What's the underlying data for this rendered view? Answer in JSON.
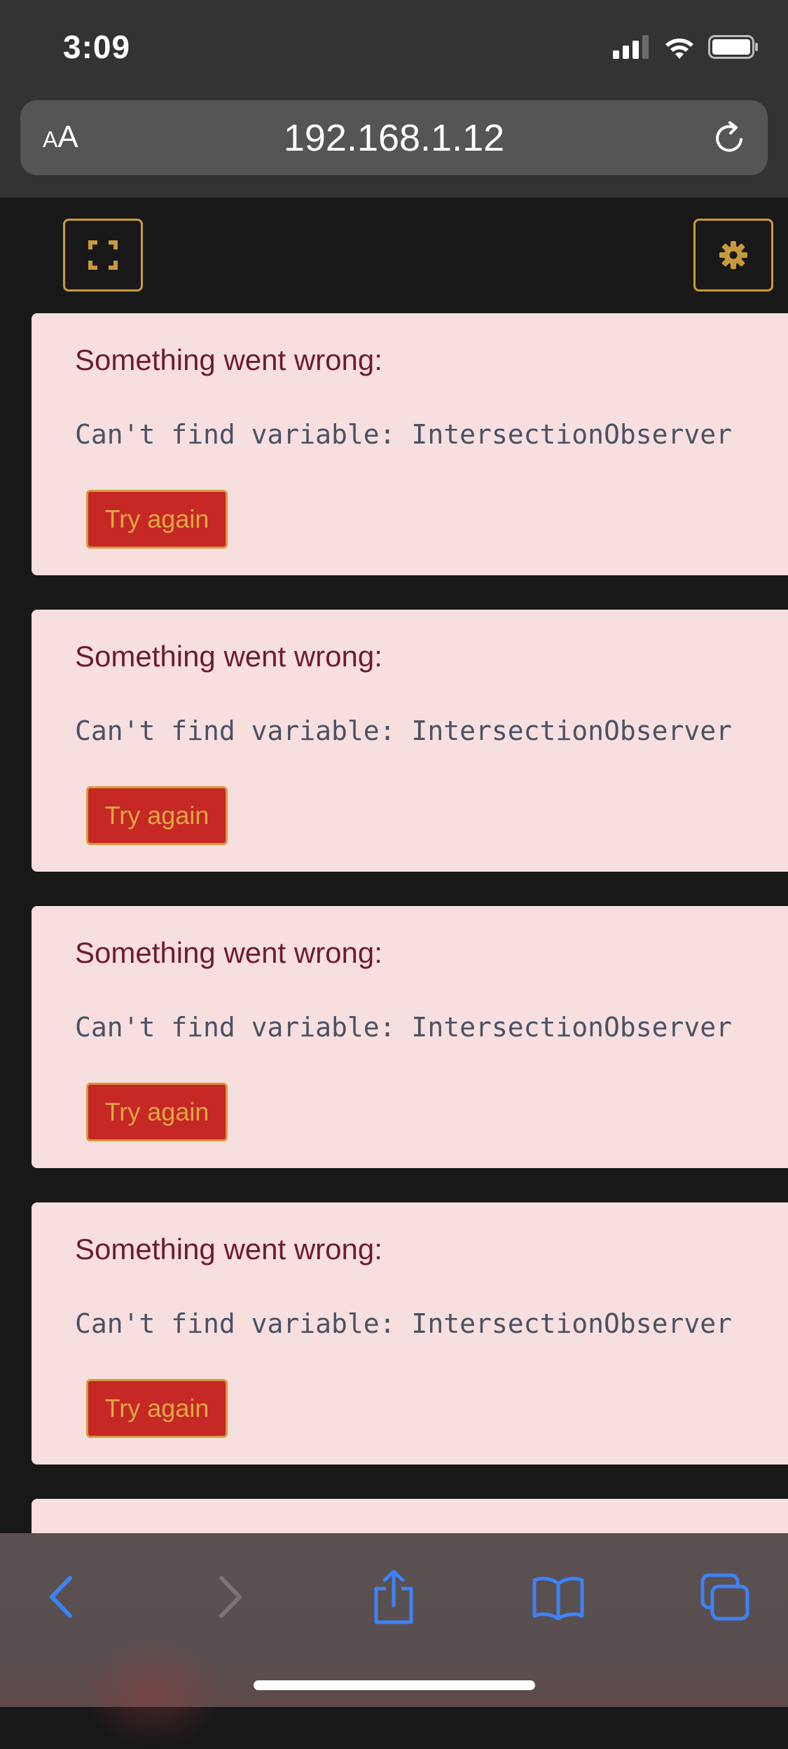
{
  "status_bar": {
    "time": "3:09"
  },
  "browser": {
    "text_size_label_small": "A",
    "text_size_label_large": "A",
    "url": "192.168.1.12"
  },
  "page": {
    "errors": [
      {
        "title": "Something went wrong:",
        "message": "Can't find variable: IntersectionObserver",
        "button_label": "Try again"
      },
      {
        "title": "Something went wrong:",
        "message": "Can't find variable: IntersectionObserver",
        "button_label": "Try again"
      },
      {
        "title": "Something went wrong:",
        "message": "Can't find variable: IntersectionObserver",
        "button_label": "Try again"
      },
      {
        "title": "Something went wrong:",
        "message": "Can't find variable: IntersectionObserver",
        "button_label": "Try again"
      }
    ]
  },
  "icons": {
    "fullscreen": "fullscreen-icon",
    "settings": "gear-icon",
    "back": "chevron-left-icon",
    "forward": "chevron-right-icon",
    "share": "share-icon",
    "bookmarks": "book-icon",
    "tabs": "tabs-icon",
    "reload": "reload-icon"
  },
  "colors": {
    "accent_gold": "#c99a3a",
    "error_background": "#f7dfe0",
    "error_title": "#6f1d28",
    "button_red": "#c62825",
    "safari_blue": "#3e82f7"
  }
}
